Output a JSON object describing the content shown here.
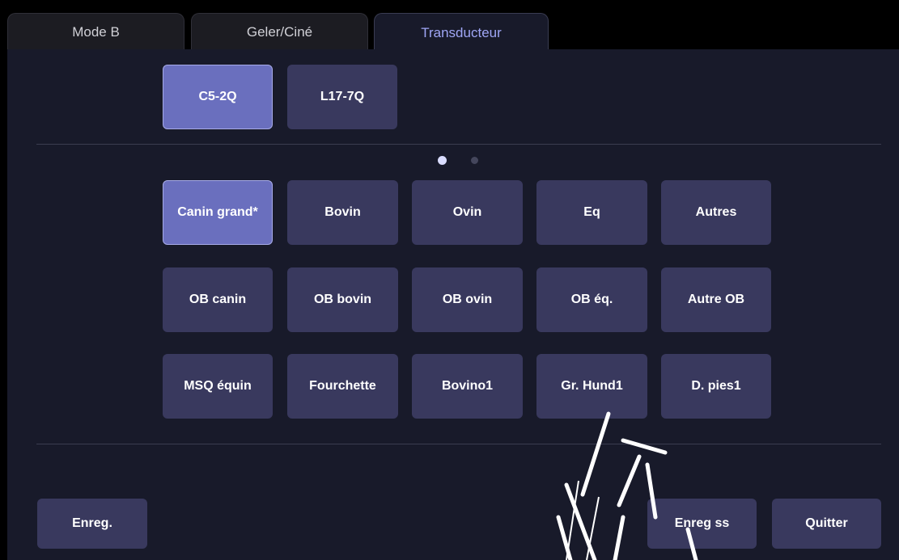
{
  "tabs": [
    {
      "label": "Mode B",
      "active": false
    },
    {
      "label": "Geler/Ciné",
      "active": false
    },
    {
      "label": "Transducteur",
      "active": true
    }
  ],
  "probes": [
    {
      "label": "C5-2Q",
      "selected": true
    },
    {
      "label": "L17-7Q",
      "selected": false
    }
  ],
  "pagination": {
    "pages": 2,
    "current": 1
  },
  "presets": [
    [
      {
        "label": "Canin grand*",
        "selected": true
      },
      {
        "label": "Bovin",
        "selected": false
      },
      {
        "label": "Ovin",
        "selected": false
      },
      {
        "label": "Eq",
        "selected": false
      },
      {
        "label": "Autres",
        "selected": false
      }
    ],
    [
      {
        "label": "OB canin",
        "selected": false
      },
      {
        "label": "OB bovin",
        "selected": false
      },
      {
        "label": "OB ovin",
        "selected": false
      },
      {
        "label": "OB éq.",
        "selected": false
      },
      {
        "label": "Autre OB",
        "selected": false
      }
    ],
    [
      {
        "label": "MSQ équin",
        "selected": false
      },
      {
        "label": "Fourchette",
        "selected": false
      },
      {
        "label": "Bovino1",
        "selected": false
      },
      {
        "label": "Gr. Hund1",
        "selected": false
      },
      {
        "label": "D. pies1",
        "selected": false
      }
    ]
  ],
  "footer": {
    "save_label": "Enreg.",
    "save_as_label": "Enreg ss",
    "quit_label": "Quitter"
  },
  "colors": {
    "panel": "#181a2a",
    "button": "#39395e",
    "button_selected": "#6a6fbe",
    "tab_active_text": "#9fa6f5",
    "dot_active": "#d9dcff",
    "dot_inactive": "#44465c"
  }
}
